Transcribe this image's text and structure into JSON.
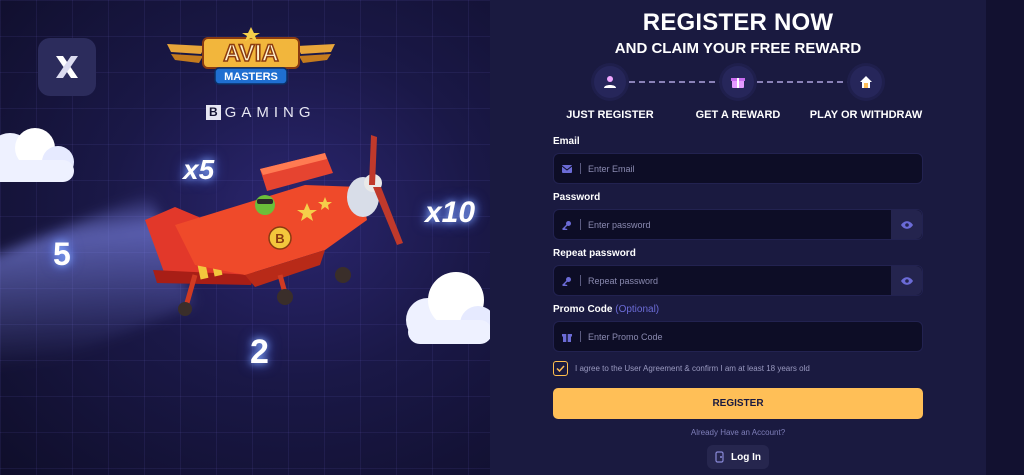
{
  "promo": {
    "logo_line1": "AVIA",
    "logo_line2": "MASTERS",
    "provider": "GAMING",
    "multipliers": [
      "x5",
      "x10",
      "5",
      "2"
    ],
    "plane_badge": "B"
  },
  "form": {
    "title": "REGISTER NOW",
    "subtitle": "AND CLAIM YOUR FREE REWARD",
    "steps": [
      {
        "label": "JUST REGISTER",
        "icon": "user-check-icon"
      },
      {
        "label": "GET A REWARD",
        "icon": "gift-icon"
      },
      {
        "label": "PLAY OR WITHDRAW",
        "icon": "home-up-icon"
      }
    ],
    "email": {
      "label": "Email",
      "placeholder": "Enter Email"
    },
    "password": {
      "label": "Password",
      "placeholder": "Enter password"
    },
    "repeat_password": {
      "label": "Repeat password",
      "placeholder": "Repeat password"
    },
    "promo": {
      "label": "Promo Code",
      "optional": "(Optional)",
      "placeholder": "Enter Promo Code"
    },
    "agreement": "I agree to the User Agreement & confirm I am at least 18 years old",
    "agreement_checked": true,
    "register_label": "REGISTER",
    "already_text": "Already Have an Account?",
    "login_label": "Log In"
  },
  "colors": {
    "accent": "#ffbf57",
    "panel": "#1a1a40",
    "field_bg": "#0d0d26"
  }
}
